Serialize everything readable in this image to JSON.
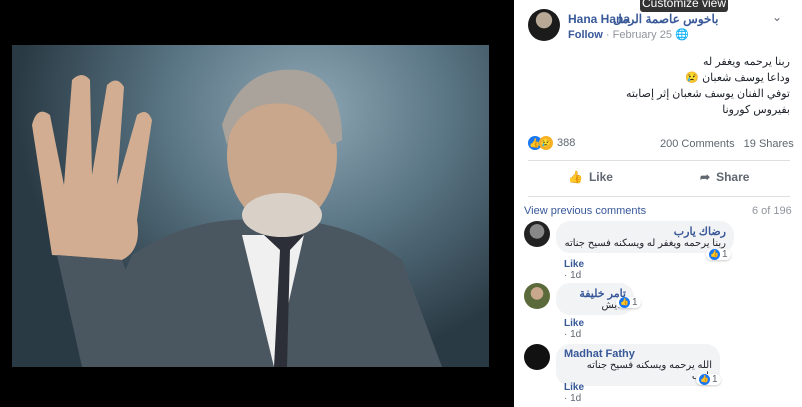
{
  "tooltip": "Customize view",
  "post": {
    "author": "Hana Hana",
    "page": "باخوس عاصمة الرمل",
    "follow": "Follow",
    "date": "February 25",
    "text_line1": "ربنا يرحمه ويغفر له",
    "text_line2": "وداعا يوسف شعبان 😢",
    "text_line3": "توفي الفنان يوسف شعبان إثر إصابته بفيروس كورونا",
    "reactions_count": "388",
    "comments_count": "200 Comments",
    "shares_count": "19 Shares",
    "like_label": "Like",
    "share_label": "Share"
  },
  "comments_header": {
    "view_previous": "View previous comments",
    "page_count": "6 of 196"
  },
  "comments": [
    {
      "name": "رضاك يارب",
      "text": "ربنا يرحمه ويغفر له ويسكنه فسيح جناته",
      "like": "Like",
      "time": "1d",
      "likes": "1"
    },
    {
      "name": "تامر خليفة",
      "text": "عايش",
      "like": "Like",
      "time": "1d",
      "likes": "1"
    },
    {
      "name": "Madhat Fathy",
      "text": "الله يرحمه ويسكنه فسيح جناته يارب",
      "like": "Like",
      "time": "1d",
      "likes": "1"
    }
  ],
  "colors": {
    "link": "#385898",
    "muted": "#606770",
    "like_blue": "#1877f2",
    "sad_yellow": "#f7b125"
  }
}
